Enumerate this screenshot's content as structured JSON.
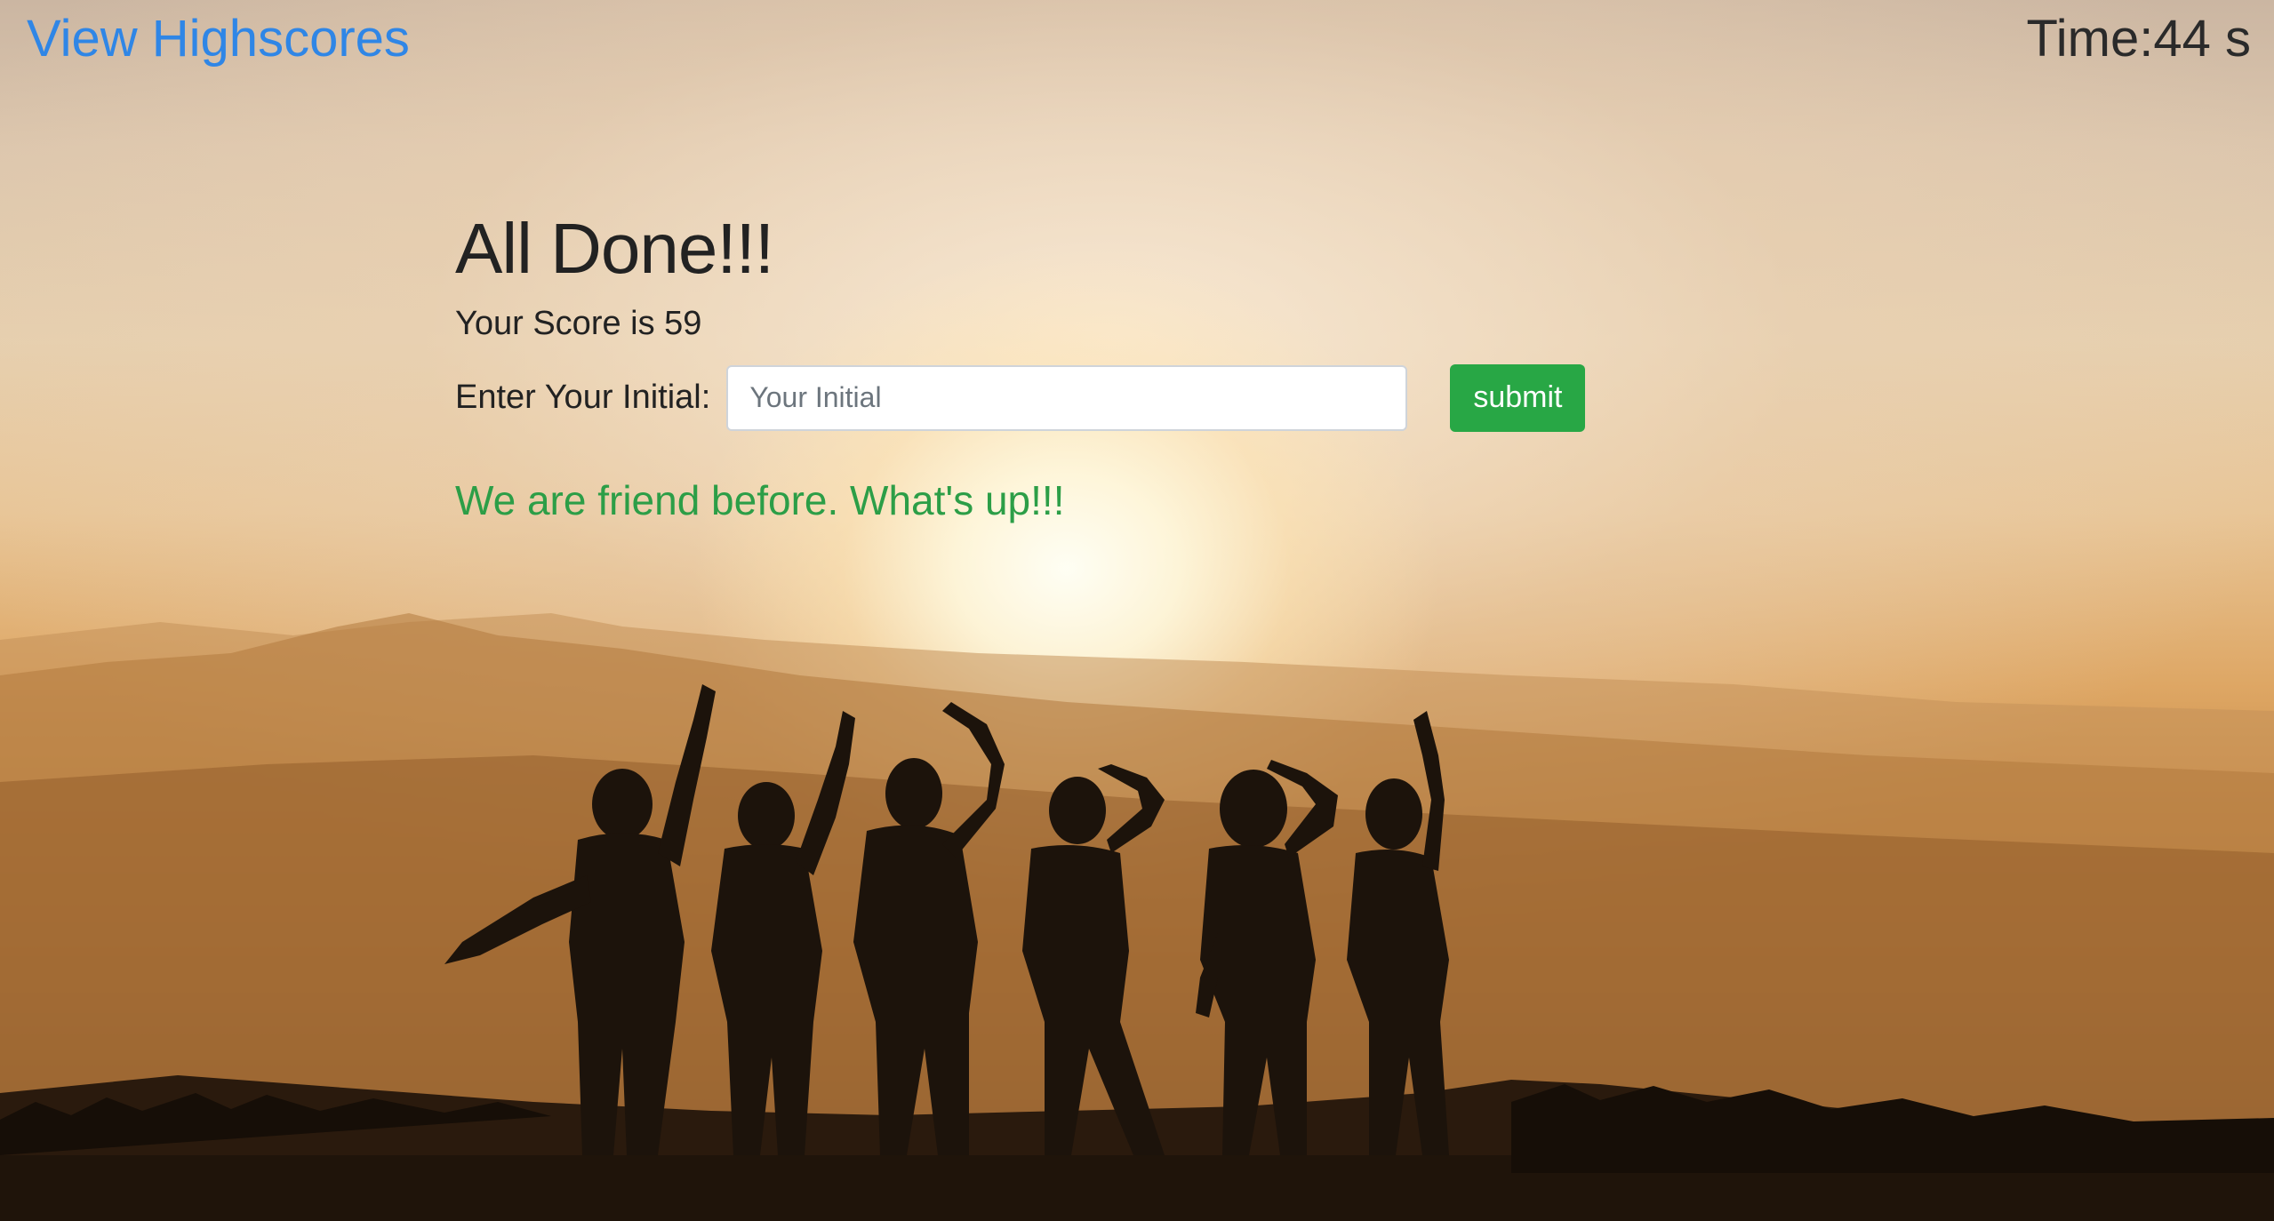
{
  "header": {
    "highscores_link": "View Highscores",
    "timer_prefix": "Time:",
    "timer_value": "44",
    "timer_unit": " s"
  },
  "result": {
    "title": "All Done!!!",
    "score_prefix": "Your Score is ",
    "score_value": "59"
  },
  "form": {
    "label": "Enter Your Initial:",
    "input_value": "",
    "input_placeholder": "Your Initial",
    "submit_label": "submit"
  },
  "message": "We are friend before. What's up!!!",
  "colors": {
    "link": "#2f86e6",
    "submit_button": "#28a745",
    "message": "#2c9e47"
  },
  "background": {
    "scene": "sunset silhouette of six people waving on a hill"
  }
}
